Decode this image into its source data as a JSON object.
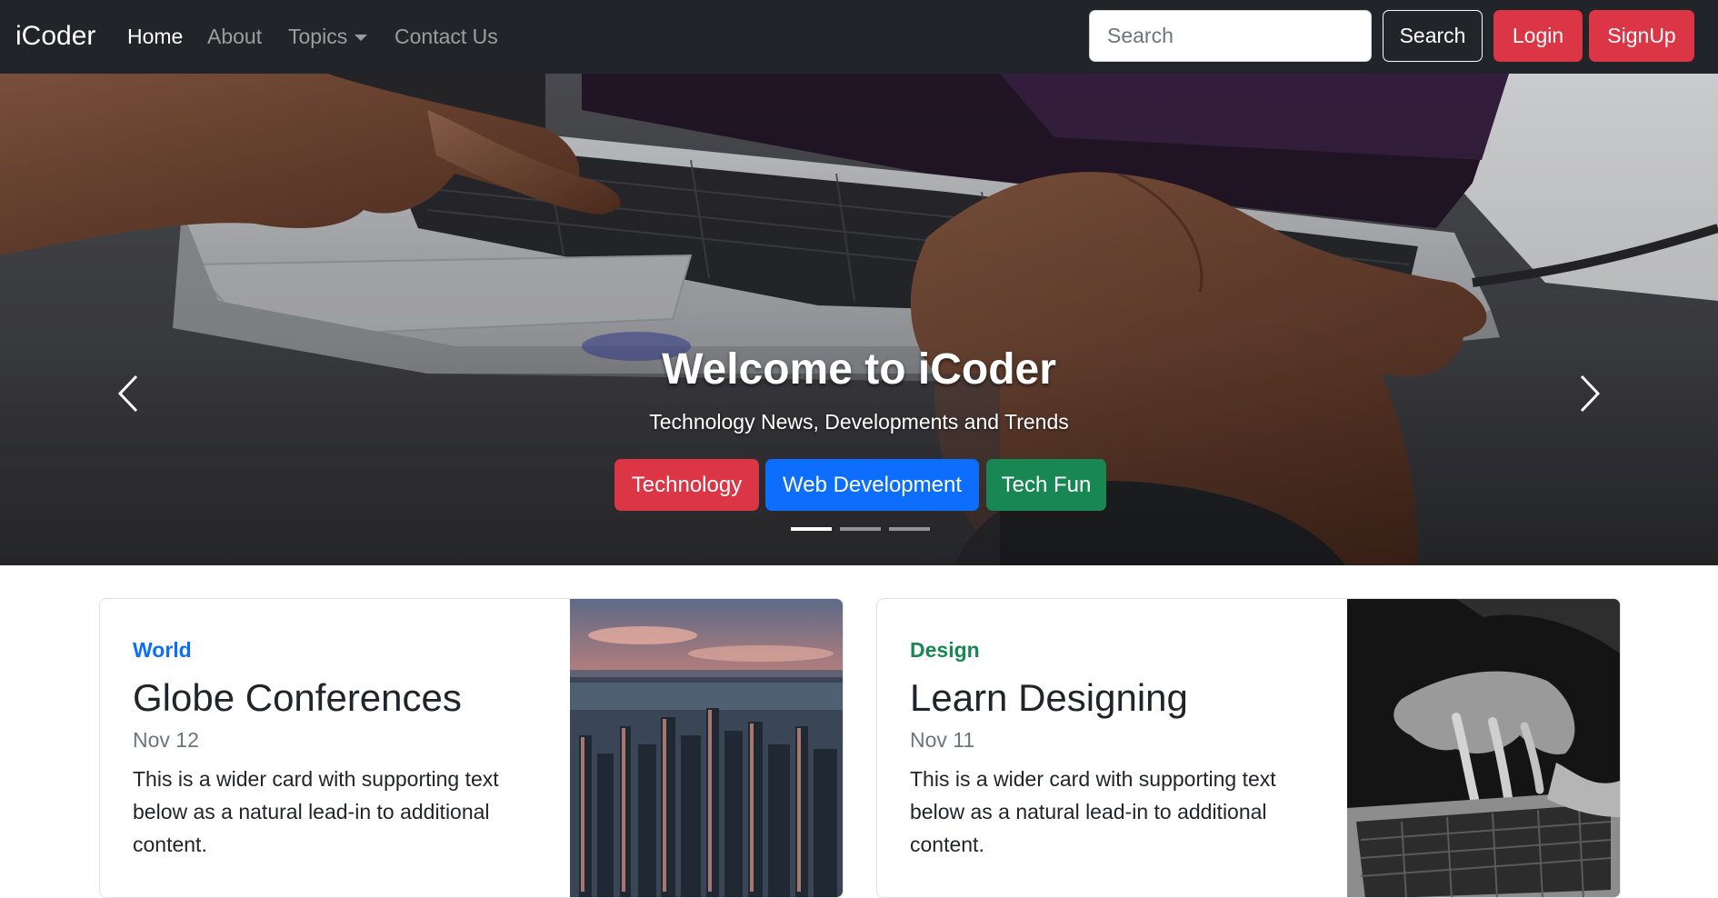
{
  "navbar": {
    "brand": "iCoder",
    "links": [
      {
        "label": "Home"
      },
      {
        "label": "About"
      },
      {
        "label": "Topics"
      },
      {
        "label": "Contact Us"
      }
    ],
    "search_placeholder": "Search",
    "search_button": "Search",
    "login_button": "Login",
    "signup_button": "SignUp"
  },
  "carousel": {
    "title": "Welcome to iCoder",
    "subtitle": "Technology News, Developments and Trends",
    "buttons": [
      {
        "label": "Technology",
        "color": "#dc3545"
      },
      {
        "label": "Web Development",
        "color": "#0d6efd"
      },
      {
        "label": "Tech Fun",
        "color": "#198754"
      }
    ],
    "active_slide": 1,
    "slide_count": 3
  },
  "cards": [
    {
      "category": "World",
      "category_color": "#0d6efd",
      "title": "Globe Conferences",
      "date": "Nov 12",
      "text": "This is a wider card with supporting text below as a natural lead-in to additional content."
    },
    {
      "category": "Design",
      "category_color": "#198754",
      "title": "Learn Designing",
      "date": "Nov 11",
      "text": "This is a wider card with supporting text below as a natural lead-in to additional content."
    }
  ],
  "colors": {
    "navbar_bg": "#212529",
    "danger": "#dc3545",
    "primary": "#0d6efd",
    "success": "#198754"
  }
}
